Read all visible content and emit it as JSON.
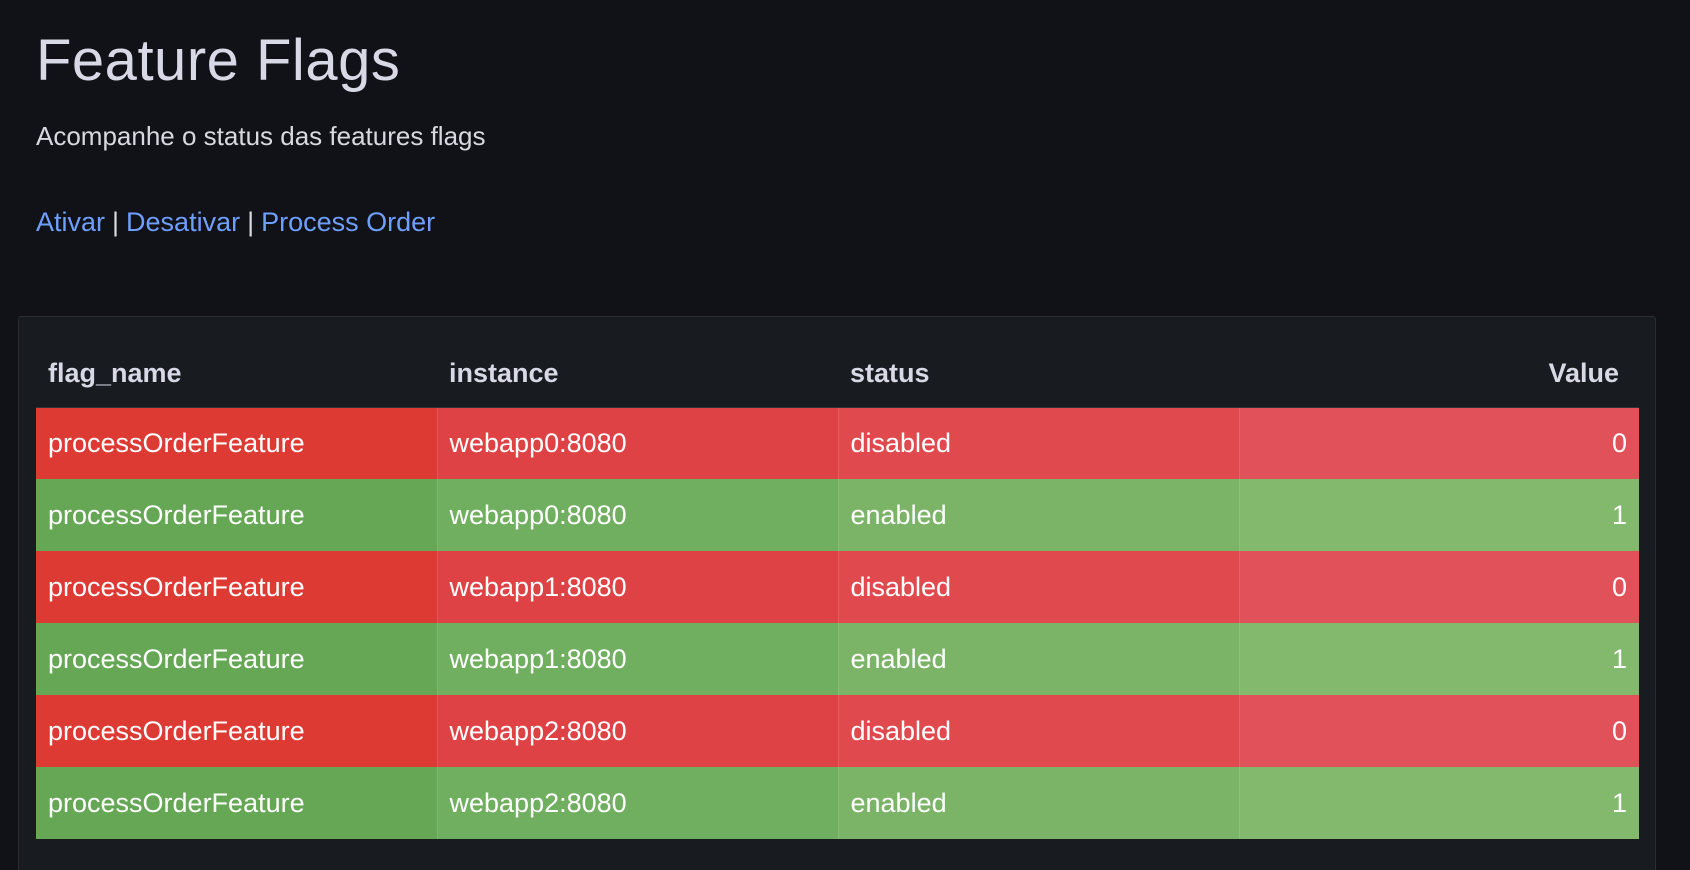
{
  "header": {
    "title": "Feature Flags",
    "subtitle": "Acompanhe o status das features flags"
  },
  "links": {
    "ativar": "Ativar",
    "separator": "|",
    "desativar": "Desativar",
    "process_order": "Process Order"
  },
  "table": {
    "columns": [
      "flag_name",
      "instance",
      "status",
      "Value"
    ],
    "rows": [
      {
        "flag_name": "processOrderFeature",
        "instance": "webapp0:8080",
        "status": "disabled",
        "value": "0"
      },
      {
        "flag_name": "processOrderFeature",
        "instance": "webapp0:8080",
        "status": "enabled",
        "value": "1"
      },
      {
        "flag_name": "processOrderFeature",
        "instance": "webapp1:8080",
        "status": "disabled",
        "value": "0"
      },
      {
        "flag_name": "processOrderFeature",
        "instance": "webapp1:8080",
        "status": "enabled",
        "value": "1"
      },
      {
        "flag_name": "processOrderFeature",
        "instance": "webapp2:8080",
        "status": "disabled",
        "value": "0"
      },
      {
        "flag_name": "processOrderFeature",
        "instance": "webapp2:8080",
        "status": "enabled",
        "value": "1"
      }
    ]
  },
  "colors": {
    "background": "#111217",
    "panel": "#181b1f",
    "link": "#6e9fff",
    "disabled_row": "#e04a4e",
    "enabled_row": "#7bb466"
  }
}
